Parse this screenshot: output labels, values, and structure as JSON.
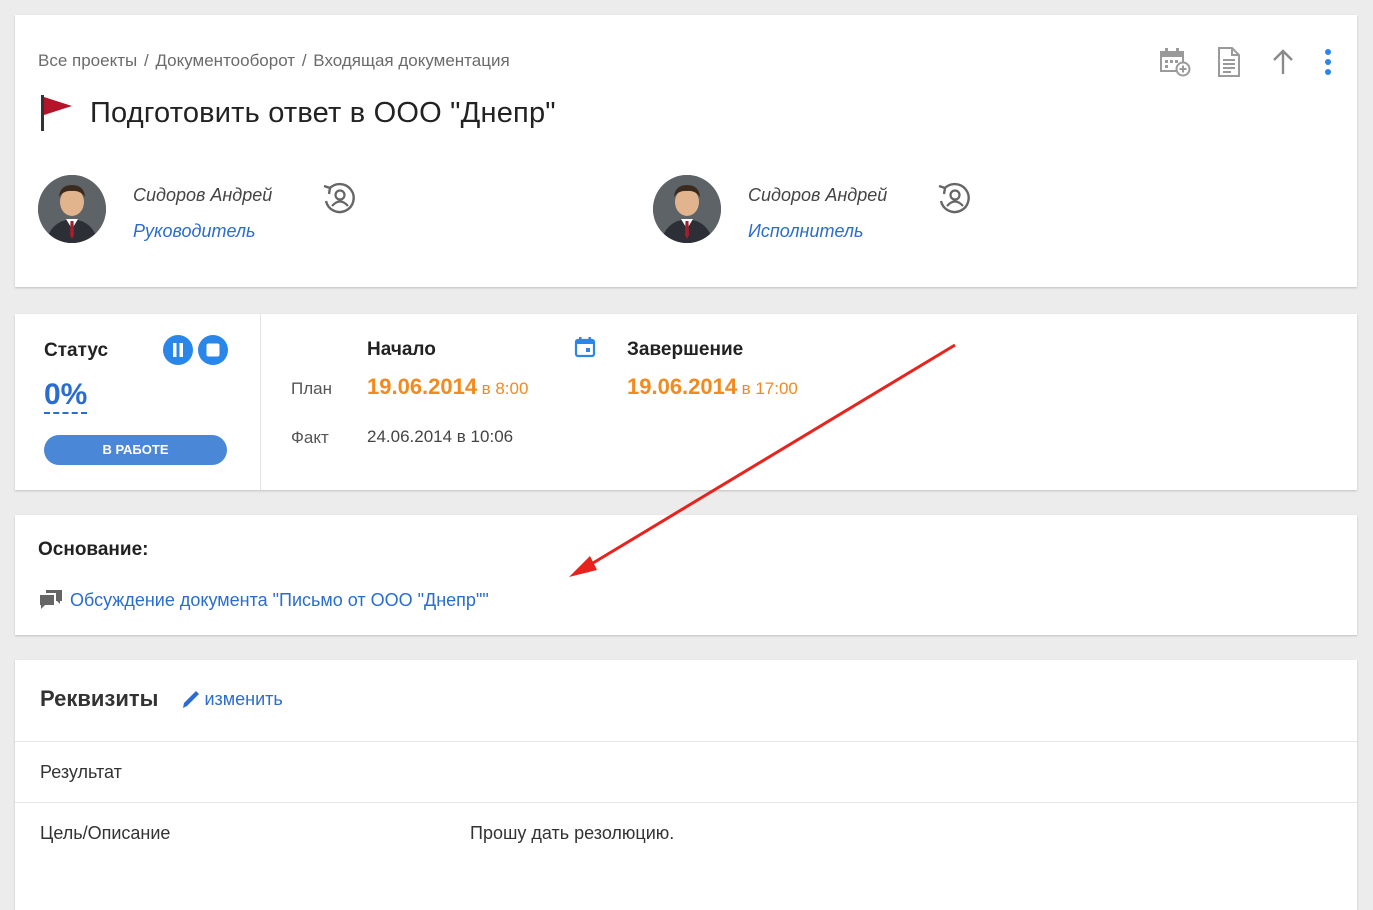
{
  "breadcrumb": [
    "Все проекты",
    "Документооборот",
    "Входящая документация"
  ],
  "title": "Подготовить ответ в ООО \"Днепр\"",
  "toolbar": {
    "icons": [
      "calendar-add-icon",
      "document-icon",
      "arrow-up-icon",
      "more-vertical-icon"
    ]
  },
  "people": [
    {
      "name": "Сидоров Андрей",
      "role": "Руководитель"
    },
    {
      "name": "Сидоров Андрей",
      "role": "Исполнитель"
    }
  ],
  "status": {
    "label": "Статус",
    "percent": "0%",
    "state_button": "В РАБОТЕ"
  },
  "dates": {
    "start_header": "Начало",
    "end_header": "Завершение",
    "plan_label": "План",
    "fact_label": "Факт",
    "plan_start_date": "19.06.2014",
    "plan_start_time": "в 8:00",
    "plan_end_date": "19.06.2014",
    "plan_end_time": "в 17:00",
    "fact_start": "24.06.2014 в 10:06"
  },
  "basis": {
    "title": "Основание:",
    "link": "Обсуждение документа \"Письмо от ООО \"Днепр\"\""
  },
  "requisites": {
    "title": "Реквизиты",
    "edit_label": "изменить",
    "rows": [
      {
        "key": "Результат",
        "value": ""
      },
      {
        "key": "Цель/Описание",
        "value": "Прошу дать резолюцию."
      }
    ]
  },
  "colors": {
    "accent": "#2a6ccf",
    "orange": "#f28a1e",
    "button": "#4a88d7",
    "flag": "#b3142a",
    "arrow": "#e8231d"
  }
}
